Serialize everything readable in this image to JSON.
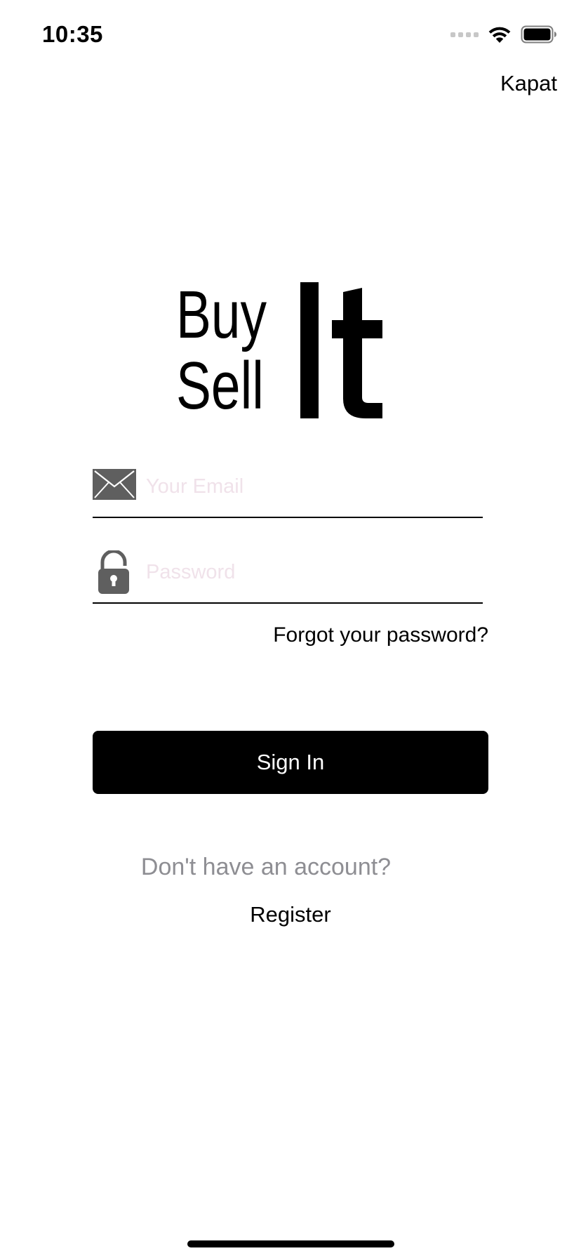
{
  "status_bar": {
    "time": "10:35"
  },
  "header": {
    "close_label": "Kapat"
  },
  "logo": {
    "text_buy": "Buy",
    "text_sell": "Sell",
    "text_it": "It"
  },
  "form": {
    "email_placeholder": "Your Email",
    "email_value": "",
    "password_placeholder": "Password",
    "password_value": "",
    "forgot_label": "Forgot your password?",
    "signin_label": "Sign In"
  },
  "footer": {
    "no_account_label": "Don't have an account?",
    "register_label": "Register"
  },
  "colors": {
    "primary": "#000000",
    "placeholder": "#f0e2ea",
    "muted_text": "#8e8e93",
    "icon_gray": "#5f5f5f"
  },
  "icons": {
    "email": "envelope-icon",
    "password": "unlock-icon",
    "wifi": "wifi-icon",
    "battery": "battery-icon",
    "signal": "signal-icon"
  }
}
